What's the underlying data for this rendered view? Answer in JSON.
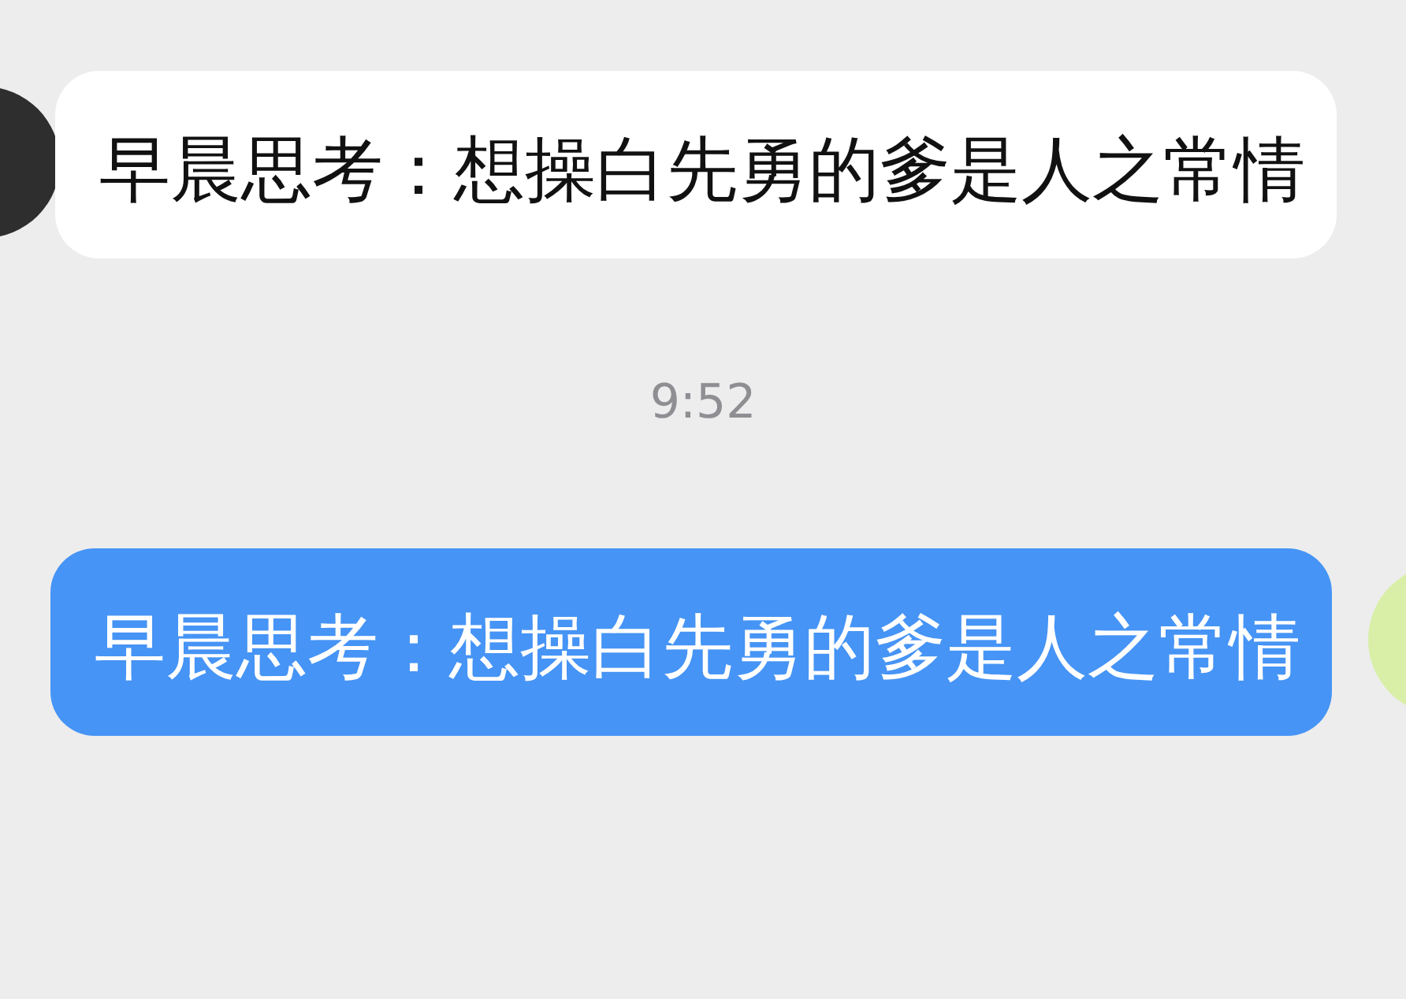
{
  "items": [
    {
      "kind": "incoming",
      "text": "早晨思考：想操白先勇的爹是人之常情"
    },
    {
      "kind": "time",
      "text": "9:52"
    },
    {
      "kind": "outgoing",
      "text": "早晨思考：想操白先勇的爹是人之常情"
    }
  ]
}
